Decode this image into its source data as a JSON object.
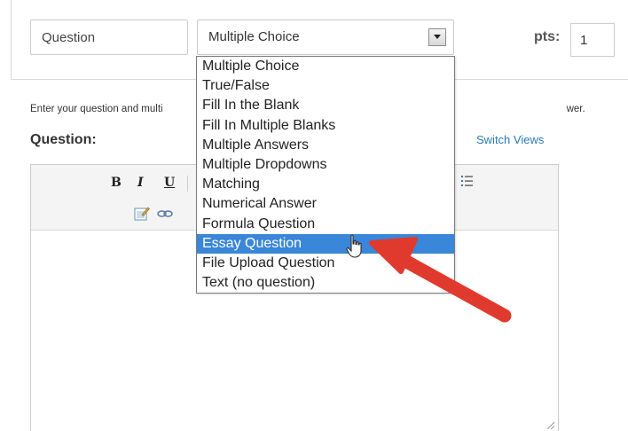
{
  "question": {
    "name_value": "Question",
    "type_selected": "Multiple Choice",
    "pts_label": "pts:",
    "pts_value": "1"
  },
  "instructions_visible": "Enter your question and multi",
  "instructions_tail": "wer.",
  "question_label": "Question:",
  "switch_views": "Switch Views",
  "toolbar": {
    "bold": "B",
    "italic": "I",
    "underline": "U"
  },
  "dropdown": {
    "items": [
      "Multiple Choice",
      "True/False",
      "Fill In the Blank",
      "Fill In Multiple Blanks",
      "Multiple Answers",
      "Multiple Dropdowns",
      "Matching",
      "Numerical Answer",
      "Formula Question",
      "Essay Question",
      "File Upload Question",
      "Text (no question)"
    ],
    "highlighted_index": 9
  },
  "colors": {
    "highlight": "#3a86d8",
    "link": "#2a7ab8",
    "annotation_arrow": "#e03a2f"
  }
}
